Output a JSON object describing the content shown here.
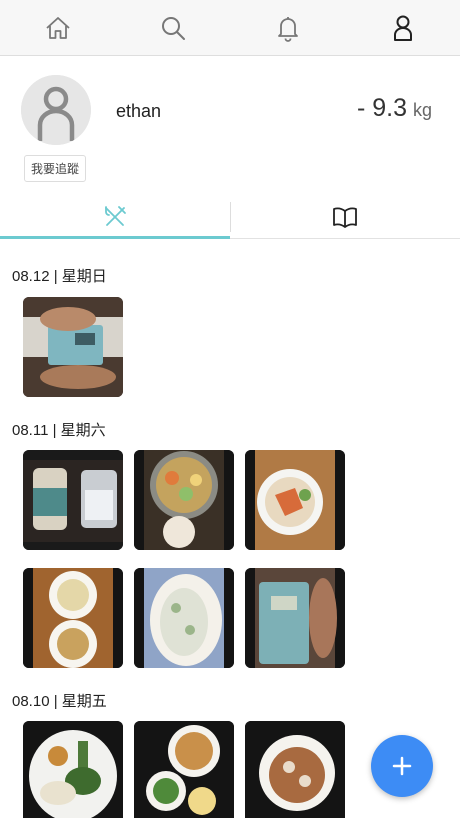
{
  "nav": {
    "tabs": [
      {
        "icon": "home-icon"
      },
      {
        "icon": "search-icon"
      },
      {
        "icon": "bell-icon"
      },
      {
        "icon": "profile-icon"
      }
    ],
    "active_index": 3
  },
  "profile": {
    "username": "ethan",
    "weight_change": "- 9.3",
    "weight_unit": "kg",
    "follow_label": "我要追蹤"
  },
  "content_tabs": [
    {
      "icon": "utensils-icon",
      "active": true
    },
    {
      "icon": "book-icon",
      "active": false
    }
  ],
  "days": [
    {
      "date": "08.12 | 星期日",
      "photos": [
        "scale-feet-photo"
      ]
    },
    {
      "date": "08.11 | 星期六",
      "photos": [
        "beer-ice-photo",
        "hotpot-photo",
        "salad-bowl-photo",
        "dumplings-photo",
        "tofu-plate-photo",
        "scale-reading-photo"
      ]
    },
    {
      "date": "08.10 | 星期五",
      "photos": [
        "vegetable-plate-photo",
        "soup-meal-photo",
        "rice-bowl-photo"
      ]
    }
  ],
  "colors": {
    "accent": "#6ccad0",
    "fab": "#3d8cf5"
  },
  "fab_icon": "plus-icon"
}
